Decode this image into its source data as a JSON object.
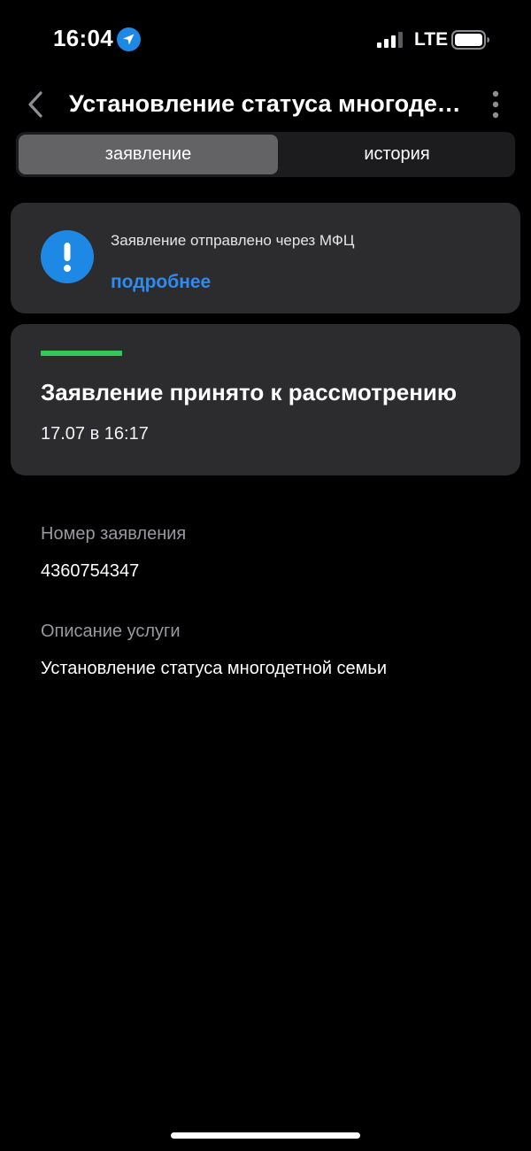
{
  "status_bar": {
    "time": "16:04",
    "network": "LTE"
  },
  "header": {
    "title": "Установление статуса многодетной семьи"
  },
  "tabs": [
    {
      "label": "заявление",
      "active": true
    },
    {
      "label": "история",
      "active": false
    }
  ],
  "notice": {
    "text": "Заявление отправлено через МФЦ",
    "link": "подробнее"
  },
  "status": {
    "title": "Заявление принято к рассмотрению",
    "date": "17.07 в 16:17"
  },
  "details": {
    "number_label": "Номер заявления",
    "number_value": "4360754347",
    "description_label": "Описание услуги",
    "description_value": "Установление статуса многодетной семьи"
  },
  "icons": {
    "location": "location-arrow-icon",
    "signal": "cellular-signal-icon",
    "battery": "battery-icon",
    "back": "chevron-left-icon",
    "more": "more-vertical-icon",
    "notice": "exclamation-icon"
  },
  "colors": {
    "accent_blue": "#1e88e5",
    "link_blue": "#2e8bf0",
    "status_green": "#34c759",
    "card_bg": "#2c2c2e"
  }
}
